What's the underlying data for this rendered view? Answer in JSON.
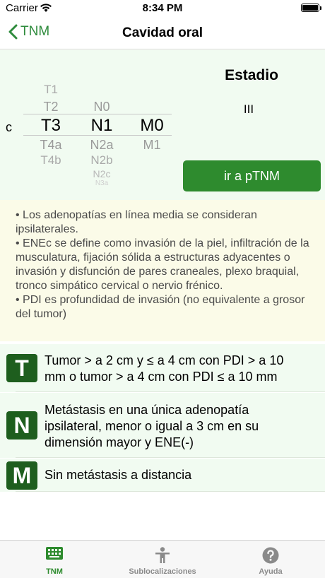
{
  "status_bar": {
    "carrier": "Carrier",
    "time": "8:34 PM"
  },
  "nav": {
    "back_label": "TNM",
    "title": "Cavidad oral"
  },
  "selector": {
    "prefix": "c",
    "t_column": {
      "above": [
        "T1",
        "T2"
      ],
      "selected": "T3",
      "below": [
        "T4a",
        "T4b"
      ]
    },
    "n_column": {
      "above": [
        "N0"
      ],
      "selected": "N1",
      "below": [
        "N2a",
        "N2b",
        "N2c",
        "N3a"
      ]
    },
    "m_column": {
      "above": [],
      "selected": "M0",
      "below": [
        "M1"
      ]
    }
  },
  "estadio": {
    "title": "Estadio",
    "value": "III"
  },
  "ptnm_button": "ir a pTNM",
  "notes": [
    "• Los adenopatías en línea media se consideran ipsilaterales.",
    "• ENEc se define como invasión de la piel, infiltración de la musculatura, fijación sólida a estructuras adyacentes o invasión y disfunción  de pares craneales, plexo braquial, tronco simpático cervical o nervio frénico.",
    "• PDI es profundidad de invasión (no equivalente a grosor del tumor)"
  ],
  "tnm_rows": [
    {
      "letter": "T",
      "text": "Tumor > a 2 cm y ≤ a 4 cm con PDI > a 10 mm o  tumor > a 4 cm con PDI ≤ a 10 mm"
    },
    {
      "letter": "N",
      "text": "Metástasis en una única adenopatía ipsilateral, menor o igual a 3 cm en su dimensión mayor y ENE(-)"
    },
    {
      "letter": "M",
      "text": "Sin metástasis a distancia"
    }
  ],
  "tabs": [
    {
      "label": "TNM",
      "icon": "keyboard-icon"
    },
    {
      "label": "Sublocalizaciones",
      "icon": "person-icon"
    },
    {
      "label": "Ayuda",
      "icon": "question-icon"
    }
  ],
  "colors": {
    "accent": "#2e8b2e",
    "badge": "#1e5e1e",
    "panel": "#f1fbf1",
    "notes_bg": "#fbfbe8"
  }
}
